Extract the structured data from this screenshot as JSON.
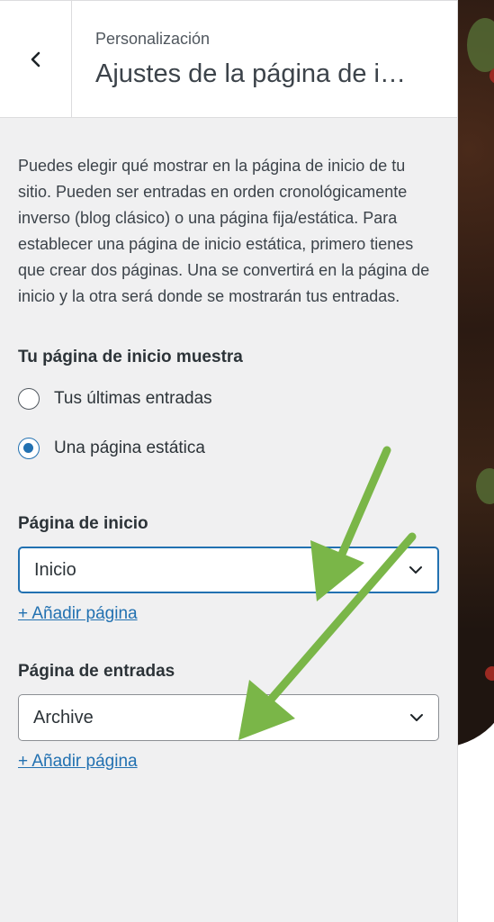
{
  "header": {
    "breadcrumb": "Personalización",
    "title": "Ajustes de la página de i…"
  },
  "description": "Puedes elegir qué mostrar en la página de inicio de tu sitio. Pueden ser entradas en orden cronológicamente inverso (blog clásico) o una página fija/estática. Para establecer una página de inicio estática, primero tienes que crear dos páginas. Una se convertirá en la página de inicio y la otra será donde se mostrarán tus entradas.",
  "homepage_display": {
    "label": "Tu página de inicio muestra",
    "options": [
      {
        "label": "Tus últimas entradas",
        "checked": false
      },
      {
        "label": "Una página estática",
        "checked": true
      }
    ]
  },
  "front_page": {
    "label": "Página de inicio",
    "selected": "Inicio",
    "add_link": "+ Añadir página"
  },
  "posts_page": {
    "label": "Página de entradas",
    "selected": "Archive",
    "add_link": "+ Añadir página"
  },
  "colors": {
    "accent": "#2271b1",
    "arrow": "#7ab648"
  }
}
